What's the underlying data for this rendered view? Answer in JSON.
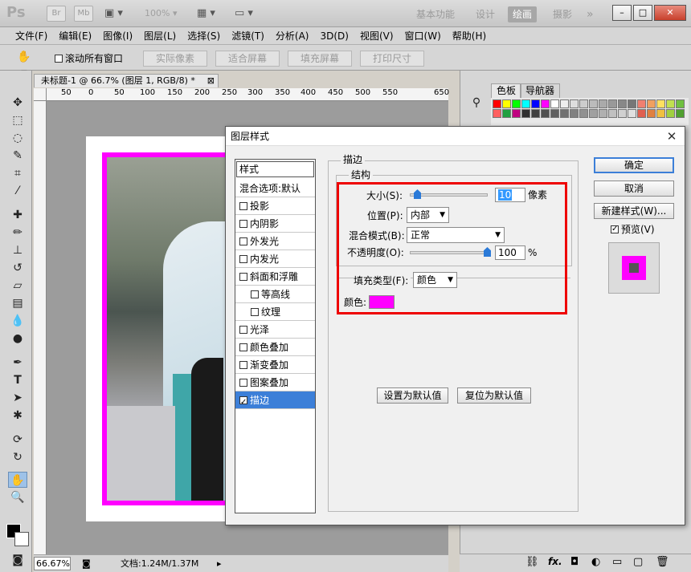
{
  "app": {
    "logo": "Ps",
    "bridge": "Br",
    "minibridge": "Mb",
    "zoom": "100%",
    "workspaces": [
      "基本功能",
      "设计",
      "绘画",
      "摄影"
    ],
    "active_workspace": "绘画",
    "more": "»"
  },
  "menu": [
    "文件(F)",
    "编辑(E)",
    "图像(I)",
    "图层(L)",
    "选择(S)",
    "滤镜(T)",
    "分析(A)",
    "3D(D)",
    "视图(V)",
    "窗口(W)",
    "帮助(H)"
  ],
  "options": {
    "scroll_all": "滚动所有窗口",
    "buttons": [
      "实际像素",
      "适合屏幕",
      "填充屏幕",
      "打印尺寸"
    ]
  },
  "document": {
    "tab_title": "未标题-1 @ 66.7% (图层 1, RGB/8) *",
    "ruler_ticks": [
      "50",
      "0",
      "50",
      "100",
      "150",
      "200",
      "250",
      "300",
      "350",
      "400",
      "450",
      "500",
      "550",
      "650"
    ],
    "zoom": "66.67%",
    "doc_info": "文档:1.24M/1.37M"
  },
  "panels": {
    "tabs": [
      "色板",
      "导航器"
    ]
  },
  "dialog": {
    "title": "图层样式",
    "styles_header": "样式",
    "styles": [
      {
        "label": "混合选项:默认",
        "checkbox": false,
        "checked": false
      },
      {
        "label": "投影",
        "checkbox": true,
        "checked": false
      },
      {
        "label": "内阴影",
        "checkbox": true,
        "checked": false
      },
      {
        "label": "外发光",
        "checkbox": true,
        "checked": false
      },
      {
        "label": "内发光",
        "checkbox": true,
        "checked": false
      },
      {
        "label": "斜面和浮雕",
        "checkbox": true,
        "checked": false
      },
      {
        "label": "等高线",
        "checkbox": true,
        "checked": false,
        "indent": true
      },
      {
        "label": "纹理",
        "checkbox": true,
        "checked": false,
        "indent": true
      },
      {
        "label": "光泽",
        "checkbox": true,
        "checked": false
      },
      {
        "label": "颜色叠加",
        "checkbox": true,
        "checked": false
      },
      {
        "label": "渐变叠加",
        "checkbox": true,
        "checked": false
      },
      {
        "label": "图案叠加",
        "checkbox": true,
        "checked": false
      },
      {
        "label": "描边",
        "checkbox": true,
        "checked": true,
        "selected": true
      }
    ],
    "section_title": "描边",
    "structure_title": "结构",
    "size_label": "大小(S):",
    "size_value": "10",
    "size_unit": "像素",
    "position_label": "位置(P):",
    "position_value": "内部",
    "blend_label": "混合模式(B):",
    "blend_value": "正常",
    "opacity_label": "不透明度(O):",
    "opacity_value": "100",
    "opacity_unit": "%",
    "fill_type_label": "填充类型(F):",
    "fill_type_value": "颜色",
    "color_label": "颜色:",
    "stroke_color": "#ff00ff",
    "set_default": "设置为默认值",
    "reset_default": "复位为默认值",
    "ok": "确定",
    "cancel": "取消",
    "new_style": "新建样式(W)...",
    "preview_label": "预览(V)",
    "preview_checked": true,
    "size_slider": 0.03,
    "opacity_slider": 1.0
  }
}
